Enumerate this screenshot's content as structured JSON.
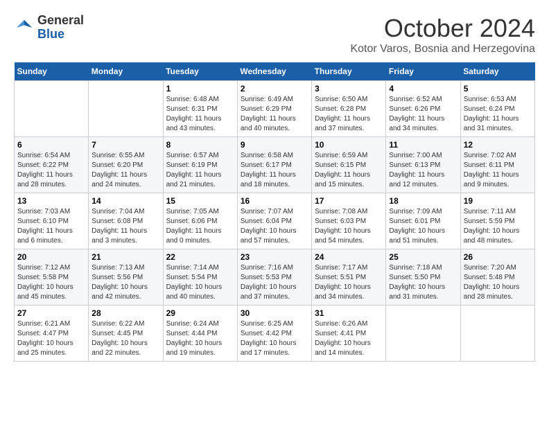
{
  "header": {
    "logo_general": "General",
    "logo_blue": "Blue",
    "month_title": "October 2024",
    "location": "Kotor Varos, Bosnia and Herzegovina"
  },
  "weekdays": [
    "Sunday",
    "Monday",
    "Tuesday",
    "Wednesday",
    "Thursday",
    "Friday",
    "Saturday"
  ],
  "weeks": [
    [
      {
        "day": "",
        "info": ""
      },
      {
        "day": "",
        "info": ""
      },
      {
        "day": "1",
        "info": "Sunrise: 6:48 AM\nSunset: 6:31 PM\nDaylight: 11 hours and 43 minutes."
      },
      {
        "day": "2",
        "info": "Sunrise: 6:49 AM\nSunset: 6:29 PM\nDaylight: 11 hours and 40 minutes."
      },
      {
        "day": "3",
        "info": "Sunrise: 6:50 AM\nSunset: 6:28 PM\nDaylight: 11 hours and 37 minutes."
      },
      {
        "day": "4",
        "info": "Sunrise: 6:52 AM\nSunset: 6:26 PM\nDaylight: 11 hours and 34 minutes."
      },
      {
        "day": "5",
        "info": "Sunrise: 6:53 AM\nSunset: 6:24 PM\nDaylight: 11 hours and 31 minutes."
      }
    ],
    [
      {
        "day": "6",
        "info": "Sunrise: 6:54 AM\nSunset: 6:22 PM\nDaylight: 11 hours and 28 minutes."
      },
      {
        "day": "7",
        "info": "Sunrise: 6:55 AM\nSunset: 6:20 PM\nDaylight: 11 hours and 24 minutes."
      },
      {
        "day": "8",
        "info": "Sunrise: 6:57 AM\nSunset: 6:19 PM\nDaylight: 11 hours and 21 minutes."
      },
      {
        "day": "9",
        "info": "Sunrise: 6:58 AM\nSunset: 6:17 PM\nDaylight: 11 hours and 18 minutes."
      },
      {
        "day": "10",
        "info": "Sunrise: 6:59 AM\nSunset: 6:15 PM\nDaylight: 11 hours and 15 minutes."
      },
      {
        "day": "11",
        "info": "Sunrise: 7:00 AM\nSunset: 6:13 PM\nDaylight: 11 hours and 12 minutes."
      },
      {
        "day": "12",
        "info": "Sunrise: 7:02 AM\nSunset: 6:11 PM\nDaylight: 11 hours and 9 minutes."
      }
    ],
    [
      {
        "day": "13",
        "info": "Sunrise: 7:03 AM\nSunset: 6:10 PM\nDaylight: 11 hours and 6 minutes."
      },
      {
        "day": "14",
        "info": "Sunrise: 7:04 AM\nSunset: 6:08 PM\nDaylight: 11 hours and 3 minutes."
      },
      {
        "day": "15",
        "info": "Sunrise: 7:05 AM\nSunset: 6:06 PM\nDaylight: 11 hours and 0 minutes."
      },
      {
        "day": "16",
        "info": "Sunrise: 7:07 AM\nSunset: 6:04 PM\nDaylight: 10 hours and 57 minutes."
      },
      {
        "day": "17",
        "info": "Sunrise: 7:08 AM\nSunset: 6:03 PM\nDaylight: 10 hours and 54 minutes."
      },
      {
        "day": "18",
        "info": "Sunrise: 7:09 AM\nSunset: 6:01 PM\nDaylight: 10 hours and 51 minutes."
      },
      {
        "day": "19",
        "info": "Sunrise: 7:11 AM\nSunset: 5:59 PM\nDaylight: 10 hours and 48 minutes."
      }
    ],
    [
      {
        "day": "20",
        "info": "Sunrise: 7:12 AM\nSunset: 5:58 PM\nDaylight: 10 hours and 45 minutes."
      },
      {
        "day": "21",
        "info": "Sunrise: 7:13 AM\nSunset: 5:56 PM\nDaylight: 10 hours and 42 minutes."
      },
      {
        "day": "22",
        "info": "Sunrise: 7:14 AM\nSunset: 5:54 PM\nDaylight: 10 hours and 40 minutes."
      },
      {
        "day": "23",
        "info": "Sunrise: 7:16 AM\nSunset: 5:53 PM\nDaylight: 10 hours and 37 minutes."
      },
      {
        "day": "24",
        "info": "Sunrise: 7:17 AM\nSunset: 5:51 PM\nDaylight: 10 hours and 34 minutes."
      },
      {
        "day": "25",
        "info": "Sunrise: 7:18 AM\nSunset: 5:50 PM\nDaylight: 10 hours and 31 minutes."
      },
      {
        "day": "26",
        "info": "Sunrise: 7:20 AM\nSunset: 5:48 PM\nDaylight: 10 hours and 28 minutes."
      }
    ],
    [
      {
        "day": "27",
        "info": "Sunrise: 6:21 AM\nSunset: 4:47 PM\nDaylight: 10 hours and 25 minutes."
      },
      {
        "day": "28",
        "info": "Sunrise: 6:22 AM\nSunset: 4:45 PM\nDaylight: 10 hours and 22 minutes."
      },
      {
        "day": "29",
        "info": "Sunrise: 6:24 AM\nSunset: 4:44 PM\nDaylight: 10 hours and 19 minutes."
      },
      {
        "day": "30",
        "info": "Sunrise: 6:25 AM\nSunset: 4:42 PM\nDaylight: 10 hours and 17 minutes."
      },
      {
        "day": "31",
        "info": "Sunrise: 6:26 AM\nSunset: 4:41 PM\nDaylight: 10 hours and 14 minutes."
      },
      {
        "day": "",
        "info": ""
      },
      {
        "day": "",
        "info": ""
      }
    ]
  ]
}
